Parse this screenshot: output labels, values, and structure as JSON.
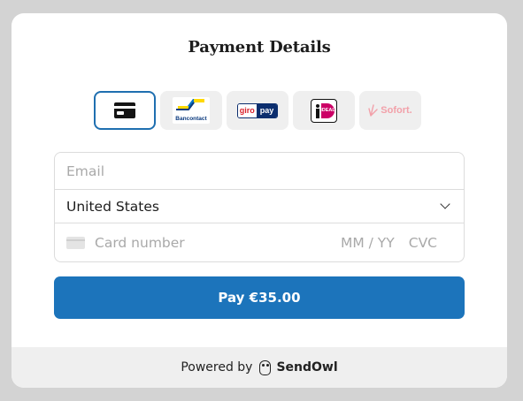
{
  "title": "Payment Details",
  "methods": [
    {
      "name": "card",
      "selected": true
    },
    {
      "name": "Bancontact",
      "label": "Bancontact"
    },
    {
      "name": "giropay",
      "label_a": "giro",
      "label_b": "pay"
    },
    {
      "name": "iDEAL",
      "label": "iDEAL"
    },
    {
      "name": "Sofort",
      "label": "Sofort."
    }
  ],
  "form": {
    "email_placeholder": "Email",
    "country_value": "United States",
    "card_placeholder": "Card number",
    "expiry_placeholder": "MM / YY",
    "cvc_placeholder": "CVC"
  },
  "pay_button_label": "Pay €35.00",
  "footer": {
    "powered_by": "Powered by",
    "brand": "SendOwl"
  },
  "colors": {
    "accent": "#1c74bb",
    "selected_border": "#1f6fb0",
    "background": "#d3d3d3"
  }
}
